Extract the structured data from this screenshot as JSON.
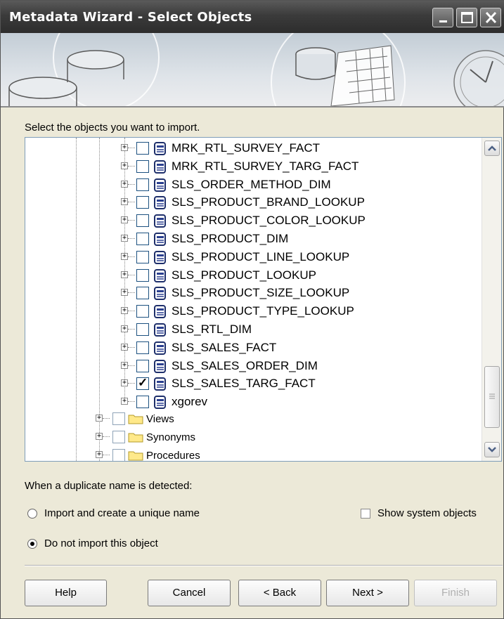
{
  "window": {
    "title": "Metadata Wizard - Select Objects"
  },
  "prompt": "Select the objects you want to import.",
  "tree": {
    "tables": [
      {
        "label": "MRK_RTL_SURVEY_FACT",
        "checked": false
      },
      {
        "label": "MRK_RTL_SURVEY_TARG_FACT",
        "checked": false
      },
      {
        "label": "SLS_ORDER_METHOD_DIM",
        "checked": false
      },
      {
        "label": "SLS_PRODUCT_BRAND_LOOKUP",
        "checked": false
      },
      {
        "label": "SLS_PRODUCT_COLOR_LOOKUP",
        "checked": false
      },
      {
        "label": "SLS_PRODUCT_DIM",
        "checked": false
      },
      {
        "label": "SLS_PRODUCT_LINE_LOOKUP",
        "checked": false
      },
      {
        "label": "SLS_PRODUCT_LOOKUP",
        "checked": false
      },
      {
        "label": "SLS_PRODUCT_SIZE_LOOKUP",
        "checked": false
      },
      {
        "label": "SLS_PRODUCT_TYPE_LOOKUP",
        "checked": false
      },
      {
        "label": "SLS_RTL_DIM",
        "checked": false
      },
      {
        "label": "SLS_SALES_FACT",
        "checked": false
      },
      {
        "label": "SLS_SALES_ORDER_DIM",
        "checked": false
      },
      {
        "label": "SLS_SALES_TARG_FACT",
        "checked": true
      },
      {
        "label": "xgorev",
        "checked": false
      }
    ],
    "folders": [
      {
        "label": "Views"
      },
      {
        "label": "Synonyms"
      },
      {
        "label": "Procedures"
      }
    ]
  },
  "duplicate": {
    "heading": "When a duplicate name is detected:",
    "option_unique": "Import and create a unique name",
    "option_skip": "Do not import this object",
    "selected": "skip",
    "show_system": "Show system objects"
  },
  "buttons": {
    "help": "Help",
    "cancel": "Cancel",
    "back": "< Back",
    "next": "Next >",
    "finish": "Finish"
  },
  "colors": {
    "titlebar": "#3b3b3b",
    "tree_border": "#7f9db9",
    "dialog_bg": "#ece9d8"
  }
}
